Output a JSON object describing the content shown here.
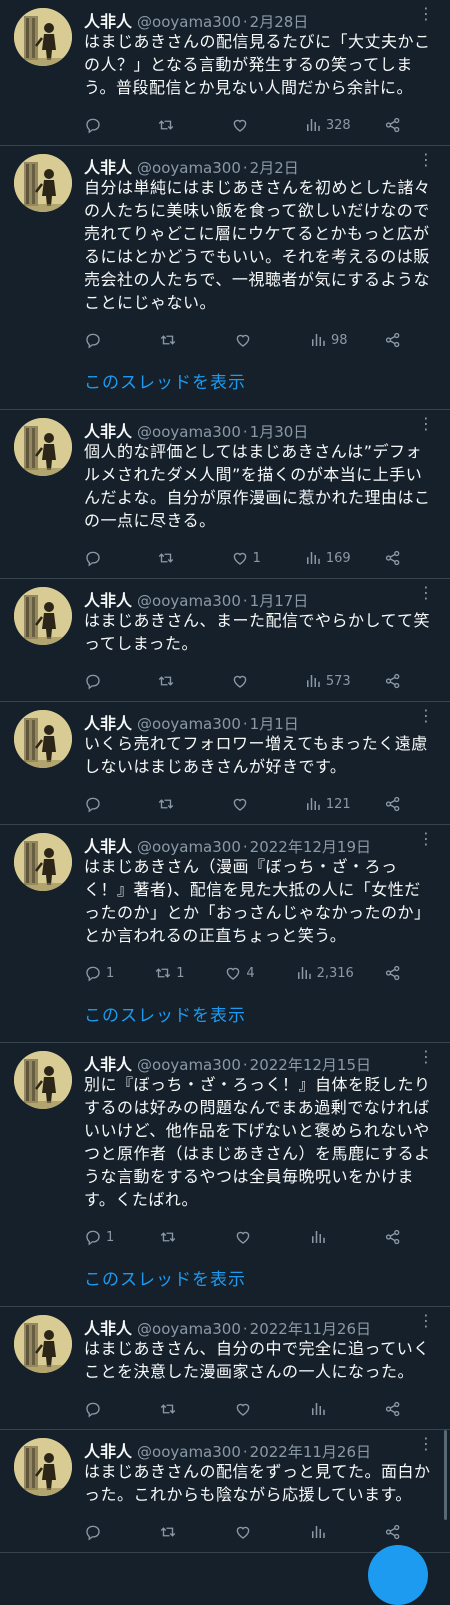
{
  "tweets": [
    {
      "name": "人非人",
      "handle": "@ooyama300",
      "date": "2月28日",
      "text": "はまじあきさんの配信見るたびに「大丈夫かこの人？」となる言動が発生するの笑ってしまう。普段配信とか見ない人間だから余計に。",
      "replies": "",
      "retweets": "",
      "likes": "",
      "views": "328",
      "thread_link": ""
    },
    {
      "name": "人非人",
      "handle": "@ooyama300",
      "date": "2月2日",
      "text": "自分は単純にはまじあきさんを初めとした諸々の人たちに美味い飯を食って欲しいだけなので売れてりゃどこに層にウケてるとかもっと広がるにはとかどうでもいい。それを考えるのは販売会社の人たちで、一視聴者が気にするようなことにじゃない。",
      "replies": "",
      "retweets": "",
      "likes": "",
      "views": "98",
      "thread_link": "このスレッドを表示"
    },
    {
      "name": "人非人",
      "handle": "@ooyama300",
      "date": "1月30日",
      "text": "個人的な評価としてはまじあきさんは”デフォルメされたダメ人間”を描くのが本当に上手いんだよな。自分が原作漫画に惹かれた理由はこの一点に尽きる。",
      "replies": "",
      "retweets": "",
      "likes": "1",
      "views": "169",
      "thread_link": ""
    },
    {
      "name": "人非人",
      "handle": "@ooyama300",
      "date": "1月17日",
      "text": "はまじあきさん、まーた配信でやらかしてて笑ってしまった。",
      "replies": "",
      "retweets": "",
      "likes": "",
      "views": "573",
      "thread_link": ""
    },
    {
      "name": "人非人",
      "handle": "@ooyama300",
      "date": "1月1日",
      "text": "いくら売れてフォロワー増えてもまったく遠慮しないはまじあきさんが好きです。",
      "replies": "",
      "retweets": "",
      "likes": "",
      "views": "121",
      "thread_link": ""
    },
    {
      "name": "人非人",
      "handle": "@ooyama300",
      "date": "2022年12月19日",
      "text": "はまじあきさん（漫画『ぼっち・ざ・ろっく！』著者)、配信を見た大抵の人に「女性だったのか」とか「おっさんじゃなかったのか」とか言われるの正直ちょっと笑う。",
      "replies": "1",
      "retweets": "1",
      "likes": "4",
      "views": "2,316",
      "thread_link": "このスレッドを表示"
    },
    {
      "name": "人非人",
      "handle": "@ooyama300",
      "date": "2022年12月15日",
      "text": "別に『ぼっち・ざ・ろっく！』自体を貶したりするのは好みの問題なんでまあ過剰でなければいいけど、他作品を下げないと褒められないやつと原作者（はまじあきさん）を馬鹿にするような言動をするやつは全員毎晩呪いをかけます。くたばれ。",
      "replies": "1",
      "retweets": "",
      "likes": "",
      "views": "",
      "thread_link": "このスレッドを表示"
    },
    {
      "name": "人非人",
      "handle": "@ooyama300",
      "date": "2022年11月26日",
      "text": "はまじあきさん、自分の中で完全に追っていくことを決意した漫画家さんの一人になった。",
      "replies": "",
      "retweets": "",
      "likes": "",
      "views": "",
      "thread_link": ""
    },
    {
      "name": "人非人",
      "handle": "@ooyama300",
      "date": "2022年11月26日",
      "text": "はまじあきさんの配信をずっと見てた。面白かった。これからも陰ながら応援しています。",
      "replies": "",
      "retweets": "",
      "likes": "",
      "views": "",
      "thread_link": ""
    }
  ],
  "colors": {
    "background": "#15202b",
    "divider": "#38444d",
    "text": "#f7f9f9",
    "muted": "#8b98a5",
    "link": "#1d9bf0"
  },
  "icons": [
    "reply-icon",
    "retweet-icon",
    "like-icon",
    "views-icon",
    "share-icon",
    "more-icon"
  ]
}
